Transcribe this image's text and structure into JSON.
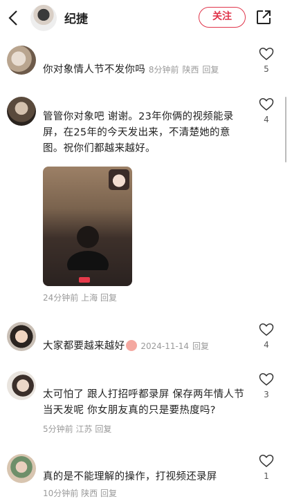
{
  "header": {
    "name": "纪捷",
    "follow_label": "关注"
  },
  "comments": [
    {
      "text": "你对象情人节不发你吗",
      "time": "8分钟前",
      "location": "陕西",
      "reply": "回复",
      "likes": "5"
    },
    {
      "text": "管管你对象吧 谢谢。23年你俩的视频能录屏，在25年的今天发出来，不清楚她的意图。祝你们都越来越好。",
      "time": "24分钟前",
      "location": "上海",
      "reply": "回复",
      "likes": "4"
    },
    {
      "text": "大家都要越来越好",
      "date": "2024-11-14",
      "reply": "回复",
      "likes": "4"
    },
    {
      "text": "太可怕了 跟人打招呼都录屏 保存两年情人节当天发呢 你女朋友真的只是要热度吗?",
      "time": "5分钟前",
      "location": "江苏",
      "reply": "回复",
      "likes": "3"
    },
    {
      "text": "真的是不能理解的操作，打视频还录屏",
      "time": "10分钟前",
      "location": "陕西",
      "reply": "回复",
      "likes": "1"
    }
  ],
  "colors": {
    "accent": "#e0344a",
    "meta": "#9a9a9a"
  }
}
